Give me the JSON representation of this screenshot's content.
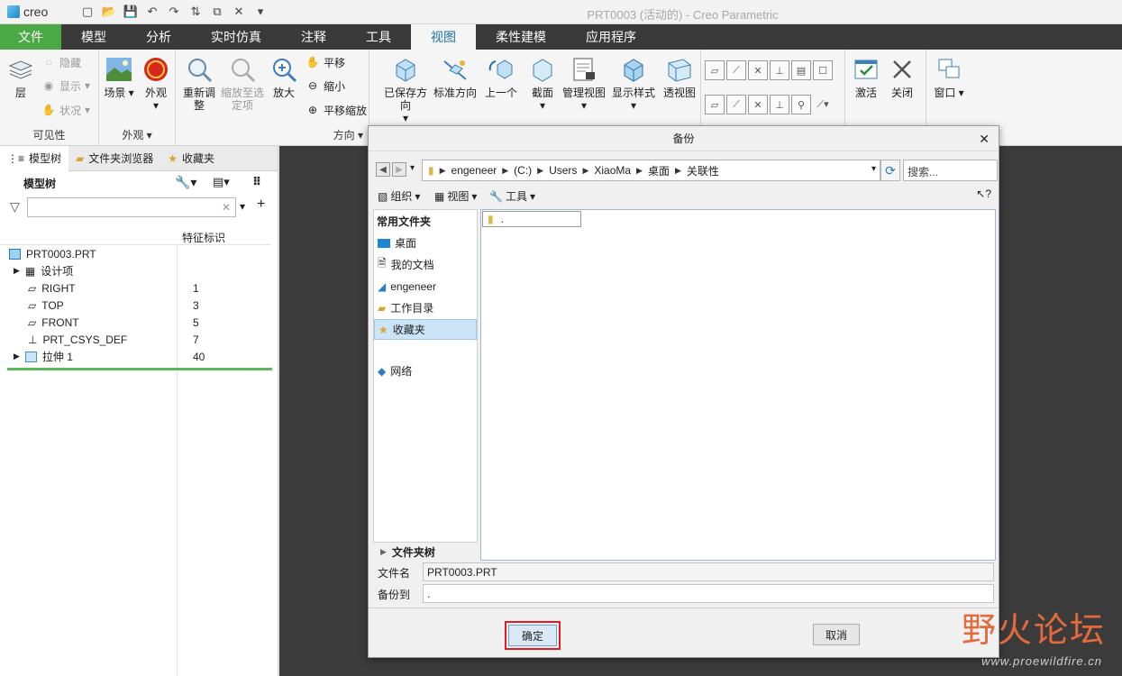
{
  "app": {
    "logo_text": "creo",
    "window_title": "PRT0003 (活动的) - Creo Parametric"
  },
  "quick_access": [
    "new-icon",
    "open-icon",
    "save-icon",
    "undo-icon",
    "redo-icon",
    "regenerate-icon",
    "window-icon",
    "close-icon"
  ],
  "tabs": [
    "文件",
    "模型",
    "分析",
    "实时仿真",
    "注释",
    "工具",
    "视图",
    "柔性建模",
    "应用程序"
  ],
  "active_tab": "视图",
  "ribbon": {
    "visibility": {
      "label": "可见性",
      "layer": "层",
      "hide": "隐藏",
      "show": "显示",
      "status": "状况"
    },
    "appearance": {
      "label": "外观",
      "scene": "场景",
      "appearance": "外观"
    },
    "orientation": {
      "label": "方向",
      "refit": "重新调整",
      "zoom_selected": "缩放至选定项",
      "zoom_in": "放大",
      "pan": "平移",
      "zoom_out": "缩小",
      "pan_zoom": "平移缩放"
    },
    "model_display": {
      "saved_views": "已保存方向",
      "standard_view": "标准方向",
      "previous": "上一个",
      "section": "截面",
      "manage_views": "管理视图",
      "display_style": "显示样式",
      "perspective": "透视图"
    },
    "window": {
      "activate": "激活",
      "close": "关闭",
      "windows": "窗口"
    }
  },
  "left_panel": {
    "tabs": [
      "模型树",
      "文件夹浏览器",
      "收藏夹"
    ],
    "tree_title": "模型树",
    "column_header": "特征标识",
    "rows": [
      {
        "label": "PRT0003.PRT",
        "id": ""
      },
      {
        "label": "设计项",
        "id": ""
      },
      {
        "label": "RIGHT",
        "id": "1"
      },
      {
        "label": "TOP",
        "id": "3"
      },
      {
        "label": "FRONT",
        "id": "5"
      },
      {
        "label": "PRT_CSYS_DEF",
        "id": "7"
      },
      {
        "label": "拉伸 1",
        "id": "40"
      }
    ]
  },
  "dialog": {
    "title": "备份",
    "path": [
      "engeneer",
      "(C:)",
      "Users",
      "XiaoMa",
      "桌面",
      "关联性"
    ],
    "search_placeholder": "搜索...",
    "toolbar": {
      "organize": "组织",
      "views": "视图",
      "tools": "工具"
    },
    "sidebar_header": "常用文件夹",
    "sidebar_items": [
      "桌面",
      "我的文档",
      "engeneer",
      "工作目录",
      "收藏夹",
      "网络"
    ],
    "selected_sidebar_item": "收藏夹",
    "file_item": ".",
    "folder_tree": "文件夹树",
    "file_name_label": "文件名",
    "file_name_value": "PRT0003.PRT",
    "backup_to_label": "备份到",
    "backup_to_value": ".",
    "ok_label": "确定",
    "cancel_label": "取消"
  },
  "watermark": {
    "text": "野火论坛",
    "url": "www.proewildfire.cn"
  },
  "colors": {
    "file_tab": "#4aa845",
    "tab_bar": "#3a3a3a",
    "active_tab_text": "#1a6ea8",
    "highlight": "#e11d1d"
  }
}
